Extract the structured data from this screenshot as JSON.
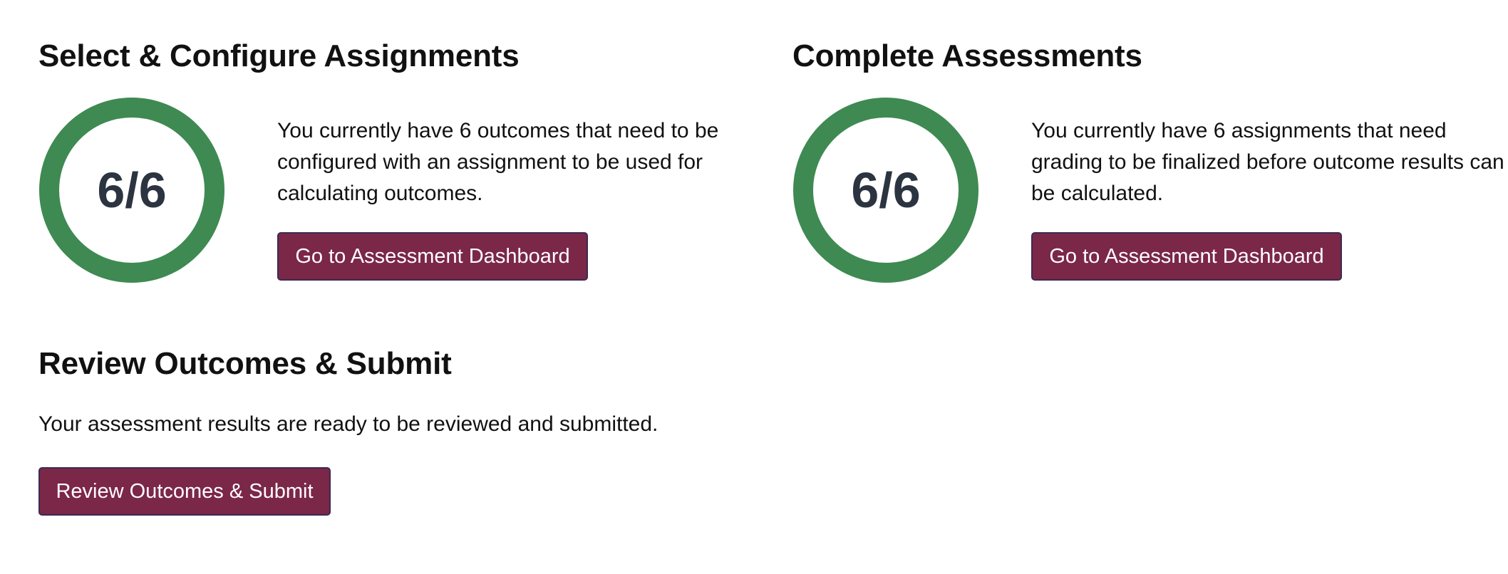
{
  "colors": {
    "ring": "#3e8a52",
    "button": "#7b2748",
    "button_border": "#3c2a52",
    "progress_text": "#2b3440"
  },
  "sections": {
    "assign": {
      "title": "Select & Configure Assignments",
      "progress_text": "6/6",
      "progress_value": 1.0,
      "description": "You currently have 6 outcomes that need to be configured with an assignment to be used for calculating outcomes.",
      "button_label": "Go to Assessment Dashboard"
    },
    "complete": {
      "title": "Complete Assessments",
      "progress_text": "6/6",
      "progress_value": 1.0,
      "description": "You currently have 6 assignments that need grading to be finalized before outcome results can be calculated.",
      "button_label": "Go to Assessment Dashboard"
    },
    "review": {
      "title": "Review Outcomes & Submit",
      "description": "Your assessment results are ready to be reviewed and submitted.",
      "button_label": "Review Outcomes & Submit"
    }
  }
}
